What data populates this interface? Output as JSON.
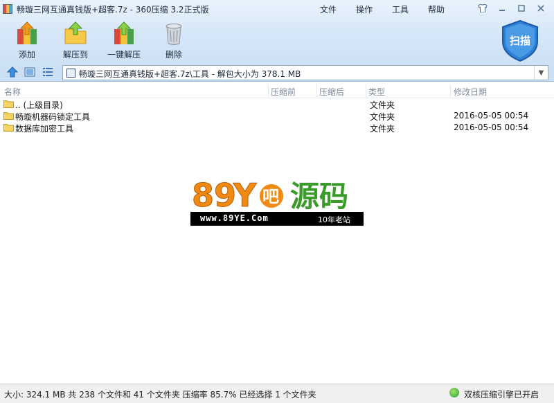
{
  "window": {
    "title": "畅璇三网互通真钱版+超客.7z - 360压缩 3.2正式版"
  },
  "menu": {
    "items": [
      "文件",
      "操作",
      "工具",
      "帮助"
    ]
  },
  "window_controls": {
    "skin": "shirt-icon",
    "minimize": "—",
    "maximize": "□",
    "close": "✕"
  },
  "toolbar": {
    "add": "添加",
    "extract_to": "解压到",
    "one_click_extract": "一键解压",
    "delete": "删除",
    "scan": "扫描"
  },
  "address": {
    "path": "畅璇三网互通真钱版+超客.7z\\工具 - 解包大小为 378.1 MB"
  },
  "columns": {
    "name": "名称",
    "before": "压缩前",
    "after": "压缩后",
    "type": "类型",
    "modified": "修改日期"
  },
  "files": [
    {
      "name": ".. (上级目录)",
      "type": "文件夹",
      "modified": ""
    },
    {
      "name": "畅璇机器码锁定工具",
      "type": "文件夹",
      "modified": "2016-05-05 00:54"
    },
    {
      "name": "数据库加密工具",
      "type": "文件夹",
      "modified": "2016-05-05 00:54"
    }
  ],
  "watermark": {
    "logo": "89Y吧源码",
    "url": "www.89YE.Com",
    "tagline": "10年老站"
  },
  "status": {
    "left": "大小: 324.1 MB 共 238 个文件和 41 个文件夹 压缩率 85.7% 已经选择 1 个文件夹",
    "right": "双核压缩引擎已开启"
  },
  "colors": {
    "chrome_top": "#eaf3fc",
    "chrome_bottom": "#c9def4",
    "shield": "#2f7fd6",
    "watermark_orange": "#f08a12",
    "watermark_green": "#3a9a2a"
  }
}
